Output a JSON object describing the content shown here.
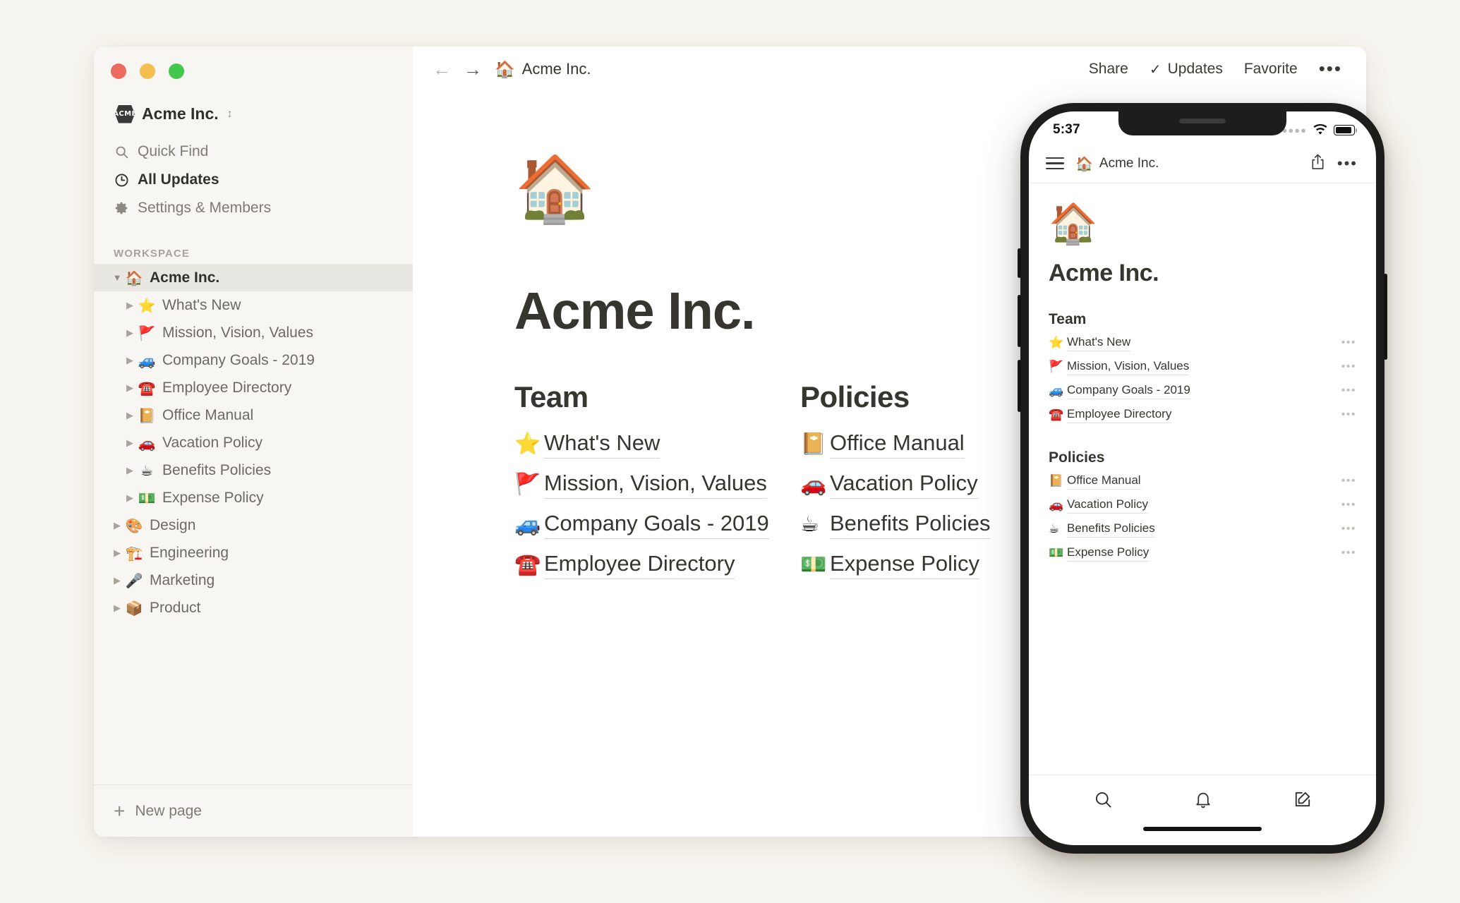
{
  "desktop": {
    "window_controls": [
      "close",
      "minimize",
      "maximize"
    ],
    "sidebar": {
      "workspace": {
        "badge_text": "ACME",
        "name": "Acme Inc.",
        "switcher_icon": "chevron-up-down-icon"
      },
      "nav_items": [
        {
          "label": "Quick Find",
          "icon": "search-icon",
          "strong": false
        },
        {
          "label": "All Updates",
          "icon": "clock-icon",
          "strong": true
        },
        {
          "label": "Settings & Members",
          "icon": "gear-icon",
          "strong": false
        }
      ],
      "section_label": "WORKSPACE",
      "tree": [
        {
          "label": "Acme Inc.",
          "emoji": "🏠",
          "depth": 0,
          "caret": "▼",
          "selected": true,
          "root": true
        },
        {
          "label": "What's New",
          "emoji": "⭐",
          "depth": 1,
          "caret": "▶",
          "selected": false,
          "root": false
        },
        {
          "label": "Mission, Vision, Values",
          "emoji": "🚩",
          "depth": 1,
          "caret": "▶",
          "selected": false,
          "root": false
        },
        {
          "label": "Company Goals - 2019",
          "emoji": "🚙",
          "depth": 1,
          "caret": "▶",
          "selected": false,
          "root": false
        },
        {
          "label": "Employee Directory",
          "emoji": "☎️",
          "depth": 1,
          "caret": "▶",
          "selected": false,
          "root": false
        },
        {
          "label": "Office Manual",
          "emoji": "📔",
          "depth": 1,
          "caret": "▶",
          "selected": false,
          "root": false
        },
        {
          "label": "Vacation Policy",
          "emoji": "🚗",
          "depth": 1,
          "caret": "▶",
          "selected": false,
          "root": false
        },
        {
          "label": "Benefits Policies",
          "emoji": "☕",
          "depth": 1,
          "caret": "▶",
          "selected": false,
          "root": false
        },
        {
          "label": "Expense Policy",
          "emoji": "💵",
          "depth": 1,
          "caret": "▶",
          "selected": false,
          "root": false
        },
        {
          "label": "Design",
          "emoji": "🎨",
          "depth": 0,
          "caret": "▶",
          "selected": false,
          "root": false
        },
        {
          "label": "Engineering",
          "emoji": "🏗️",
          "depth": 0,
          "caret": "▶",
          "selected": false,
          "root": false
        },
        {
          "label": "Marketing",
          "emoji": "🎤",
          "depth": 0,
          "caret": "▶",
          "selected": false,
          "root": false
        },
        {
          "label": "Product",
          "emoji": "📦",
          "depth": 0,
          "caret": "▶",
          "selected": false,
          "root": false
        }
      ],
      "new_page_label": "New page"
    },
    "topbar": {
      "back_icon": "arrow-left-icon",
      "forward_icon": "arrow-right-icon",
      "breadcrumb_emoji": "🏠",
      "breadcrumb_label": "Acme Inc.",
      "share_label": "Share",
      "updates_label": "Updates",
      "updates_check": "✓",
      "favorite_label": "Favorite",
      "more_icon": "ellipsis-icon",
      "more_glyph": "•••"
    },
    "page": {
      "icon": "🏠",
      "title": "Acme Inc.",
      "columns": [
        {
          "heading": "Team",
          "links": [
            {
              "emoji": "⭐",
              "label": "What's New"
            },
            {
              "emoji": "🚩",
              "label": "Mission, Vision, Values"
            },
            {
              "emoji": "🚙",
              "label": "Company Goals - 2019"
            },
            {
              "emoji": "☎️",
              "label": "Employee Directory"
            }
          ]
        },
        {
          "heading": "Policies",
          "links": [
            {
              "emoji": "📔",
              "label": "Office Manual"
            },
            {
              "emoji": "🚗",
              "label": "Vacation Policy"
            },
            {
              "emoji": "☕",
              "label": "Benefits Policies"
            },
            {
              "emoji": "💵",
              "label": "Expense Policy"
            }
          ]
        }
      ]
    }
  },
  "phone": {
    "status": {
      "time": "5:37",
      "signal_icon": "signal-dots-icon",
      "wifi_icon": "wifi-icon",
      "battery_icon": "battery-icon"
    },
    "nav": {
      "menu_icon": "hamburger-menu-icon",
      "emoji": "🏠",
      "title": "Acme Inc.",
      "share_icon": "share-icon",
      "more_icon": "ellipsis-icon",
      "more_glyph": "•••"
    },
    "page": {
      "icon": "🏠",
      "title": "Acme Inc.",
      "sections": [
        {
          "heading": "Team",
          "rows": [
            {
              "emoji": "⭐",
              "label": "What's New",
              "more": "•••"
            },
            {
              "emoji": "🚩",
              "label": "Mission, Vision, Values",
              "more": "•••"
            },
            {
              "emoji": "🚙",
              "label": "Company Goals - 2019",
              "more": "•••"
            },
            {
              "emoji": "☎️",
              "label": "Employee Directory",
              "more": "•••"
            }
          ]
        },
        {
          "heading": "Policies",
          "rows": [
            {
              "emoji": "📔",
              "label": "Office Manual",
              "more": "•••"
            },
            {
              "emoji": "🚗",
              "label": "Vacation Policy",
              "more": "•••"
            },
            {
              "emoji": "☕",
              "label": "Benefits Policies",
              "more": "•••"
            },
            {
              "emoji": "💵",
              "label": "Expense Policy",
              "more": "•••"
            }
          ]
        }
      ]
    },
    "toolbar": [
      {
        "icon": "search-icon"
      },
      {
        "icon": "bell-icon"
      },
      {
        "icon": "compose-icon"
      }
    ]
  },
  "colors": {
    "page_background": "#f7f5ef",
    "window_background": "#ffffff",
    "sidebar_background": "#f7f6f3",
    "selected_row": "#e8e7e2",
    "text_primary": "#37352f",
    "text_muted": "#7e7b73",
    "traffic_red": "#ed6a5e",
    "traffic_yellow": "#f4bd4f",
    "traffic_green": "#41c84d",
    "phone_frame": "#1d1d1b"
  }
}
